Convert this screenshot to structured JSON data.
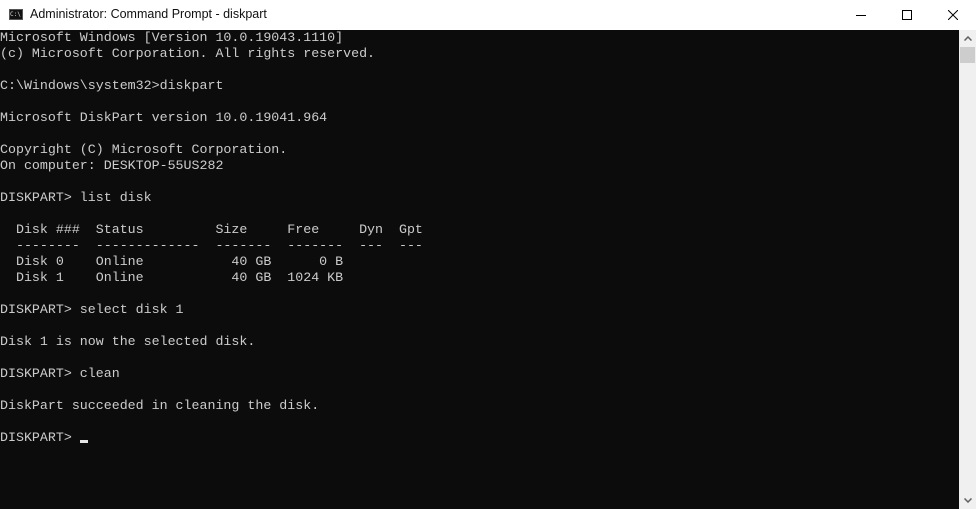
{
  "window": {
    "title": "Administrator: Command Prompt - diskpart",
    "icon": "cmd-icon",
    "controls": {
      "minimize": "minimize-icon",
      "maximize": "maximize-icon",
      "close": "close-icon"
    }
  },
  "console": {
    "lines": [
      "Microsoft Windows [Version 10.0.19043.1110]",
      "(c) Microsoft Corporation. All rights reserved.",
      "",
      "C:\\Windows\\system32>diskpart",
      "",
      "Microsoft DiskPart version 10.0.19041.964",
      "",
      "Copyright (C) Microsoft Corporation.",
      "On computer: DESKTOP-55US282",
      "",
      "DISKPART> list disk",
      "",
      "  Disk ###  Status         Size     Free     Dyn  Gpt",
      "  --------  -------------  -------  -------  ---  ---",
      "  Disk 0    Online           40 GB      0 B",
      "  Disk 1    Online           40 GB  1024 KB",
      "",
      "DISKPART> select disk 1",
      "",
      "Disk 1 is now the selected disk.",
      "",
      "DISKPART> clean",
      "",
      "DiskPart succeeded in cleaning the disk.",
      "",
      "DISKPART> "
    ],
    "disk_table": {
      "columns": [
        "Disk ###",
        "Status",
        "Size",
        "Free",
        "Dyn",
        "Gpt"
      ],
      "rows": [
        [
          "Disk 0",
          "Online",
          "40 GB",
          "0 B",
          "",
          ""
        ],
        [
          "Disk 1",
          "Online",
          "40 GB",
          "1024 KB",
          "",
          ""
        ]
      ]
    },
    "prompt": "DISKPART> "
  }
}
